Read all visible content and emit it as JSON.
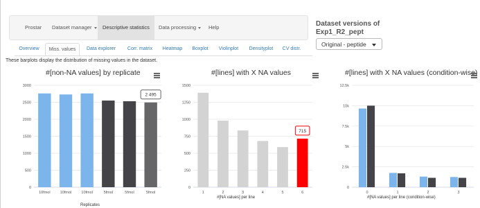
{
  "nav": {
    "brand": "Prostar",
    "items": [
      {
        "label": "Dataset manager",
        "dropdown": true
      },
      {
        "label": "Descriptive statistics",
        "active": true
      },
      {
        "label": "Data processing",
        "dropdown": true
      },
      {
        "label": "Help"
      }
    ]
  },
  "version": {
    "title": "Dataset versions of",
    "dataset": "Exp1_R2_pept",
    "selected": "Original - peptide"
  },
  "tabs": [
    "Overview",
    "Miss. values",
    "Data explorer",
    "Corr. matrix",
    "Heatmap",
    "Boxplot",
    "Violinplot",
    "Densityplot",
    "CV distr."
  ],
  "active_tab": "Miss. values",
  "description": "These barplots display the distribution of missing values in the dataset.",
  "colors": {
    "blue": "#7cb5ec",
    "black": "#434348",
    "gray": "#666668",
    "light": "#d3d3d3",
    "red": "#ff0000"
  },
  "chart_data": [
    {
      "type": "bar",
      "title": "#[non-NA values] by replicate",
      "xlabel": "Replicates",
      "categories": [
        "10fmol",
        "10fmol",
        "10fmol",
        "5fmol",
        "5fmol",
        "5fmol"
      ],
      "values": [
        2760,
        2730,
        2760,
        2550,
        2530,
        2495
      ],
      "colors": [
        "#7cb5ec",
        "#7cb5ec",
        "#7cb5ec",
        "#434348",
        "#434348",
        "#666668"
      ],
      "ylim": [
        0,
        3000
      ],
      "yticks": [
        "0",
        "500",
        "1000",
        "1500",
        "2000",
        "2500",
        "3000"
      ],
      "tooltip": {
        "index": 5,
        "text": "2 495"
      }
    },
    {
      "type": "bar",
      "title": "#[lines] with X NA values",
      "xlabel": "#[NA values] per line",
      "categories": [
        "1",
        "2",
        "3",
        "4",
        "5",
        "6"
      ],
      "values": [
        1390,
        980,
        835,
        680,
        590,
        715
      ],
      "colors": [
        "#d3d3d3",
        "#d3d3d3",
        "#d3d3d3",
        "#d3d3d3",
        "#d3d3d3",
        "#ff0000"
      ],
      "ylim": [
        0,
        1500
      ],
      "yticks": [
        "0",
        "250",
        "500",
        "750",
        "1000",
        "1250",
        "1500"
      ],
      "tooltip": {
        "index": 5,
        "text": "715"
      }
    },
    {
      "type": "bar",
      "title": "#[lines] with X NA values (condition-wise)",
      "xlabel": "#[NA values] per line (condition-wise)",
      "categories": [
        "0",
        "1",
        "2",
        "3"
      ],
      "series": [
        {
          "values": [
            9650,
            1750,
            1300,
            1250
          ],
          "color": "#7cb5ec"
        },
        {
          "values": [
            10000,
            1700,
            1150,
            1150
          ],
          "color": "#434348"
        }
      ],
      "ylim": [
        0,
        12500
      ],
      "yticks": [
        "0",
        "2.5k",
        "5k",
        "7.5k",
        "10k",
        "12.5k"
      ]
    }
  ]
}
